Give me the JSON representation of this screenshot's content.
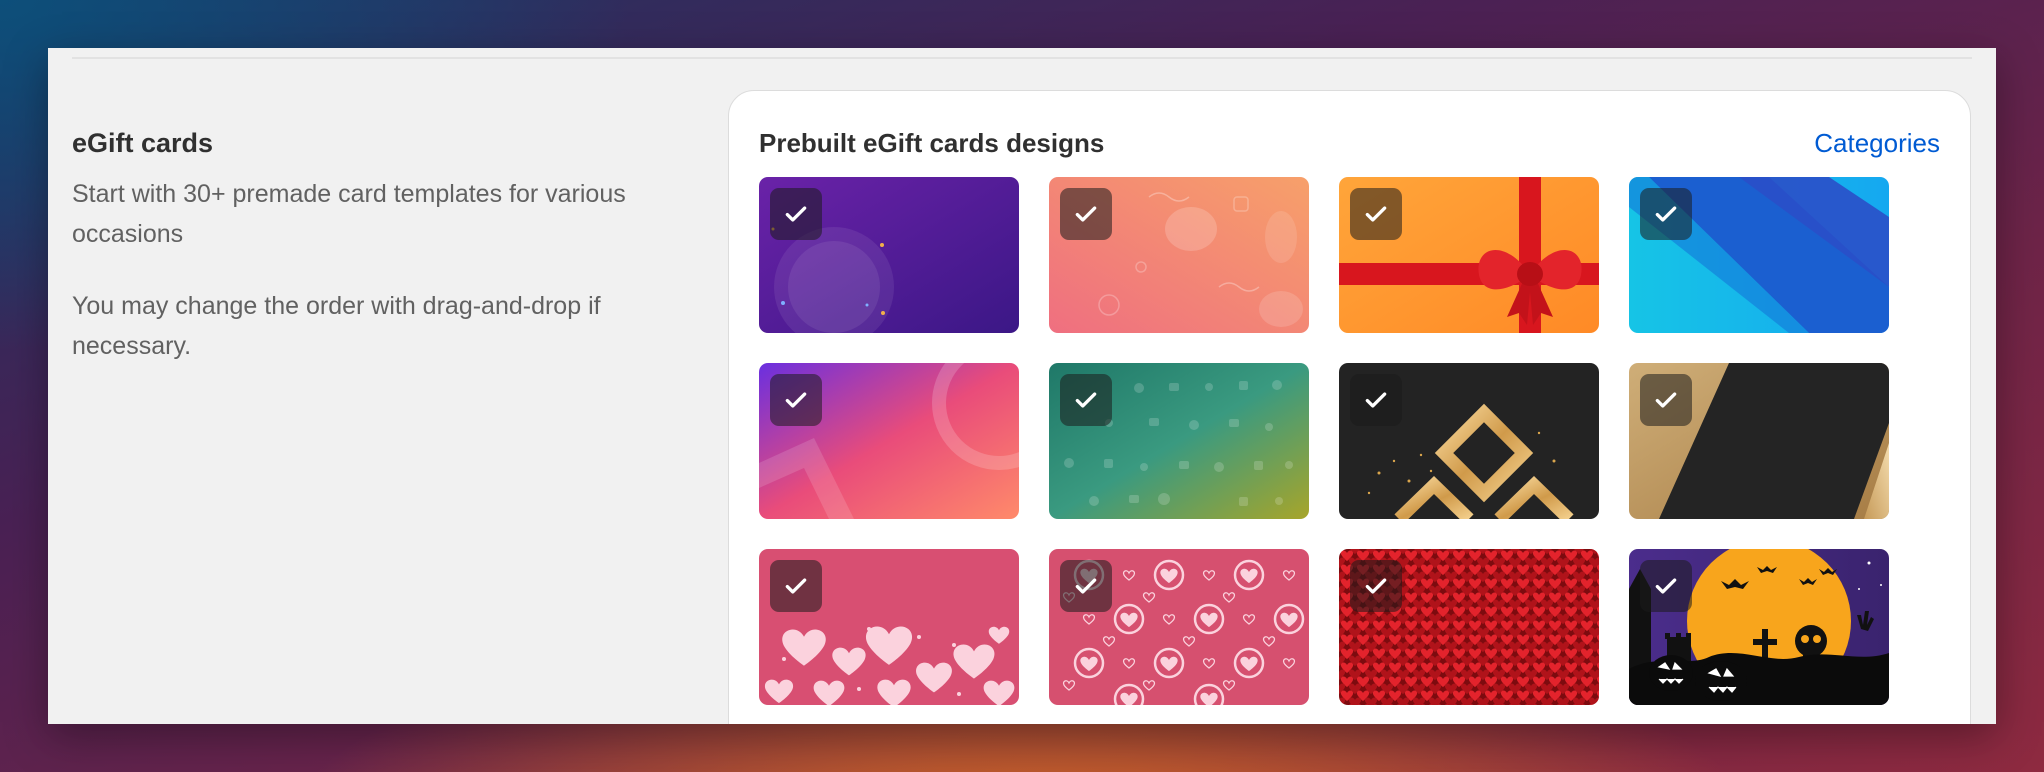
{
  "section": {
    "title": "eGift cards",
    "description": "Start with 30+ premade card templates for various occasions",
    "note": "You may change the order with drag-and-drop if necessary."
  },
  "panel": {
    "title": "Prebuilt eGift cards designs",
    "categories_link": "Categories"
  },
  "cards": [
    {
      "design": "purple-sparkle",
      "selected": true
    },
    {
      "design": "peach-doodles",
      "selected": true
    },
    {
      "design": "orange-gift-ribbon",
      "selected": true
    },
    {
      "design": "blue-cyan-gradient",
      "selected": true
    },
    {
      "design": "violet-coral-gradient",
      "selected": true
    },
    {
      "design": "teal-olive-icons",
      "selected": true
    },
    {
      "design": "black-gold-diamond",
      "selected": true
    },
    {
      "design": "gold-black-diagonal",
      "selected": true
    },
    {
      "design": "pink-hearts-bottom",
      "selected": true
    },
    {
      "design": "pink-heart-pattern",
      "selected": true
    },
    {
      "design": "red-hearts-mosaic",
      "selected": true
    },
    {
      "design": "halloween-moon",
      "selected": true
    }
  ],
  "colors": {
    "link": "#005bd3",
    "text": "#303030",
    "muted": "#616161"
  }
}
